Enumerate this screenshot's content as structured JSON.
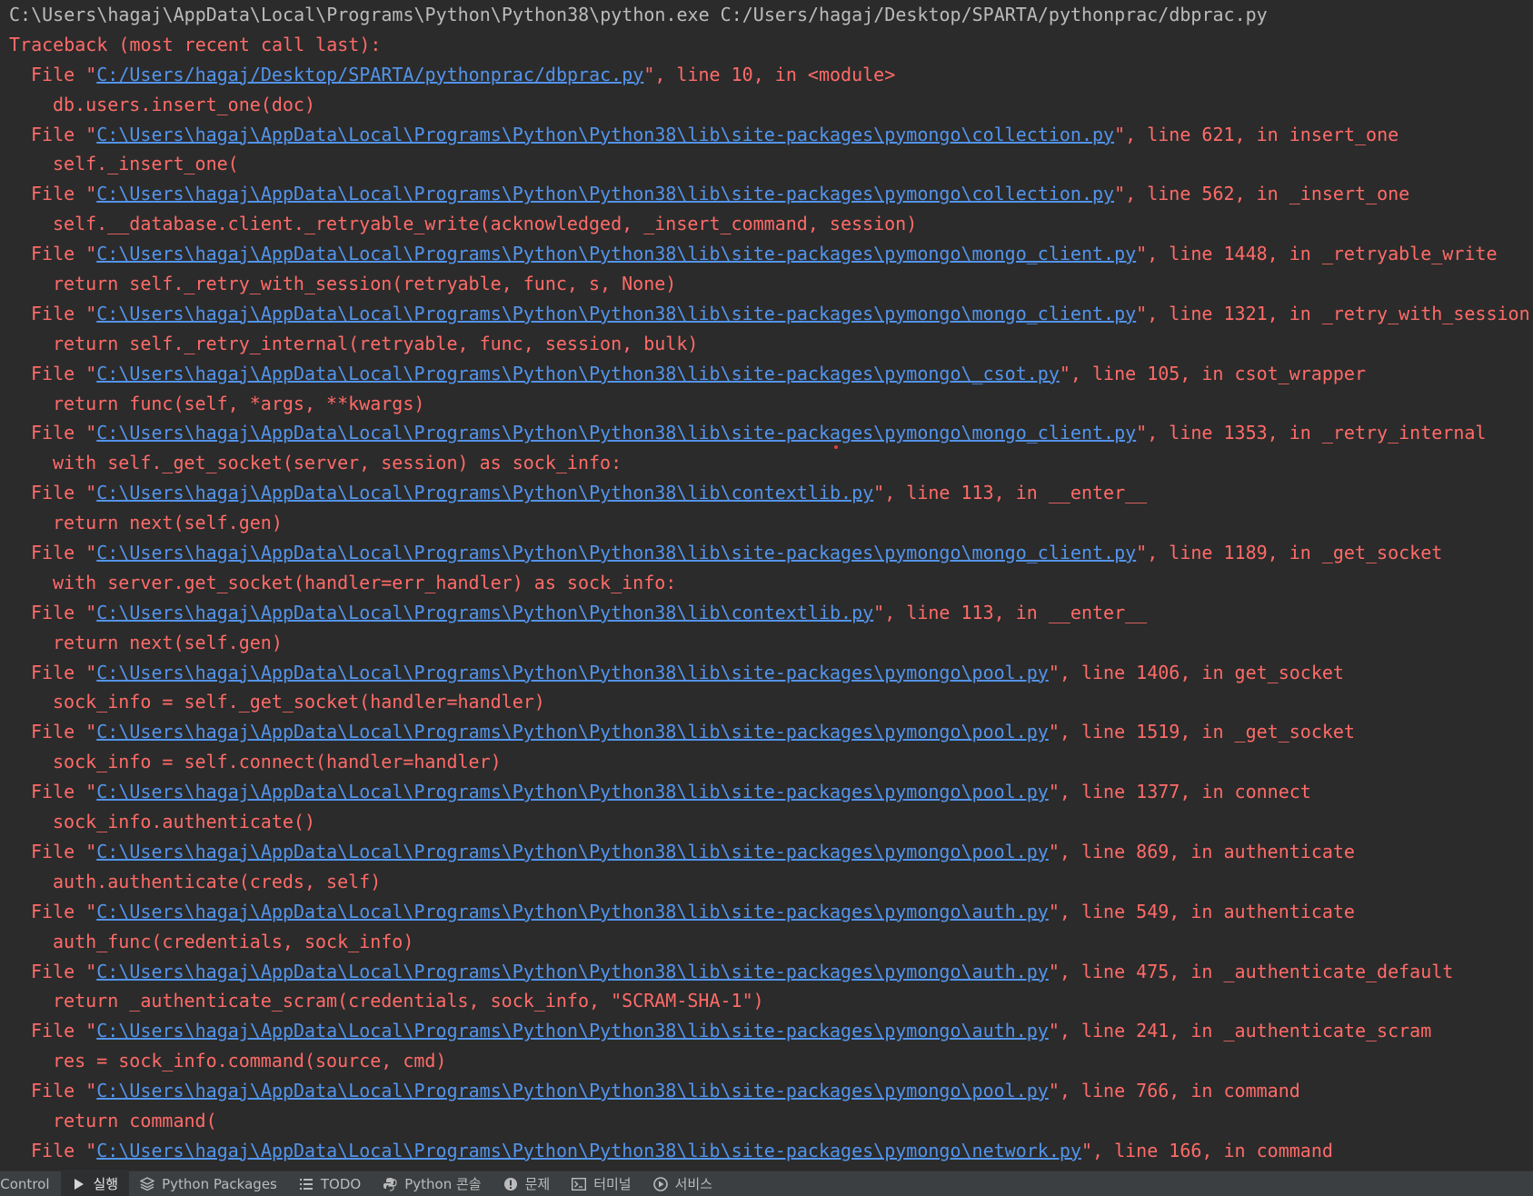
{
  "console": {
    "command": "C:\\Users\\hagaj\\AppData\\Local\\Programs\\Python\\Python38\\python.exe C:/Users/hagaj/Desktop/SPARTA/pythonprac/dbprac.py",
    "traceback_header": "Traceback (most recent call last):",
    "frames": [
      {
        "path": "C:/Users/hagaj/Desktop/SPARTA/pythonprac/dbprac.py",
        "suffix": "\", line 10, in <module>",
        "code": "db.users.insert_one(doc)"
      },
      {
        "path": "C:\\Users\\hagaj\\AppData\\Local\\Programs\\Python\\Python38\\lib\\site-packages\\pymongo\\collection.py",
        "suffix": "\", line 621, in insert_one",
        "code": "self._insert_one("
      },
      {
        "path": "C:\\Users\\hagaj\\AppData\\Local\\Programs\\Python\\Python38\\lib\\site-packages\\pymongo\\collection.py",
        "suffix": "\", line 562, in _insert_one",
        "code": "self.__database.client._retryable_write(acknowledged, _insert_command, session)"
      },
      {
        "path": "C:\\Users\\hagaj\\AppData\\Local\\Programs\\Python\\Python38\\lib\\site-packages\\pymongo\\mongo_client.py",
        "suffix": "\", line 1448, in _retryable_write",
        "code": "return self._retry_with_session(retryable, func, s, None)"
      },
      {
        "path": "C:\\Users\\hagaj\\AppData\\Local\\Programs\\Python\\Python38\\lib\\site-packages\\pymongo\\mongo_client.py",
        "suffix": "\", line 1321, in _retry_with_session",
        "code": "return self._retry_internal(retryable, func, session, bulk)"
      },
      {
        "path": "C:\\Users\\hagaj\\AppData\\Local\\Programs\\Python\\Python38\\lib\\site-packages\\pymongo\\_csot.py",
        "suffix": "\", line 105, in csot_wrapper",
        "code": "return func(self, *args, **kwargs)"
      },
      {
        "path": "C:\\Users\\hagaj\\AppData\\Local\\Programs\\Python\\Python38\\lib\\site-packages\\pymongo\\mongo_client.py",
        "suffix": "\", line 1353, in _retry_internal",
        "code": "with self._get_socket(server, session) as sock_info:"
      },
      {
        "path": "C:\\Users\\hagaj\\AppData\\Local\\Programs\\Python\\Python38\\lib\\contextlib.py",
        "suffix": "\", line 113, in __enter__",
        "code": "return next(self.gen)"
      },
      {
        "path": "C:\\Users\\hagaj\\AppData\\Local\\Programs\\Python\\Python38\\lib\\site-packages\\pymongo\\mongo_client.py",
        "suffix": "\", line 1189, in _get_socket",
        "code": "with server.get_socket(handler=err_handler) as sock_info:"
      },
      {
        "path": "C:\\Users\\hagaj\\AppData\\Local\\Programs\\Python\\Python38\\lib\\contextlib.py",
        "suffix": "\", line 113, in __enter__",
        "code": "return next(self.gen)"
      },
      {
        "path": "C:\\Users\\hagaj\\AppData\\Local\\Programs\\Python\\Python38\\lib\\site-packages\\pymongo\\pool.py",
        "suffix": "\", line 1406, in get_socket",
        "code": "sock_info = self._get_socket(handler=handler)"
      },
      {
        "path": "C:\\Users\\hagaj\\AppData\\Local\\Programs\\Python\\Python38\\lib\\site-packages\\pymongo\\pool.py",
        "suffix": "\", line 1519, in _get_socket",
        "code": "sock_info = self.connect(handler=handler)"
      },
      {
        "path": "C:\\Users\\hagaj\\AppData\\Local\\Programs\\Python\\Python38\\lib\\site-packages\\pymongo\\pool.py",
        "suffix": "\", line 1377, in connect",
        "code": "sock_info.authenticate()"
      },
      {
        "path": "C:\\Users\\hagaj\\AppData\\Local\\Programs\\Python\\Python38\\lib\\site-packages\\pymongo\\pool.py",
        "suffix": "\", line 869, in authenticate",
        "code": "auth.authenticate(creds, self)"
      },
      {
        "path": "C:\\Users\\hagaj\\AppData\\Local\\Programs\\Python\\Python38\\lib\\site-packages\\pymongo\\auth.py",
        "suffix": "\", line 549, in authenticate",
        "code": "auth_func(credentials, sock_info)"
      },
      {
        "path": "C:\\Users\\hagaj\\AppData\\Local\\Programs\\Python\\Python38\\lib\\site-packages\\pymongo\\auth.py",
        "suffix": "\", line 475, in _authenticate_default",
        "code": "return _authenticate_scram(credentials, sock_info, \"SCRAM-SHA-1\")"
      },
      {
        "path": "C:\\Users\\hagaj\\AppData\\Local\\Programs\\Python\\Python38\\lib\\site-packages\\pymongo\\auth.py",
        "suffix": "\", line 241, in _authenticate_scram",
        "code": "res = sock_info.command(source, cmd)"
      },
      {
        "path": "C:\\Users\\hagaj\\AppData\\Local\\Programs\\Python\\Python38\\lib\\site-packages\\pymongo\\pool.py",
        "suffix": "\", line 766, in command",
        "code": "return command("
      },
      {
        "path": "C:\\Users\\hagaj\\AppData\\Local\\Programs\\Python\\Python38\\lib\\site-packages\\pymongo\\network.py",
        "suffix": "\", line 166, in command",
        "code": null
      }
    ]
  },
  "toolbar": {
    "items": [
      {
        "label": "n Control",
        "icon": "none",
        "active": false
      },
      {
        "label": "실행",
        "icon": "run-icon",
        "active": true
      },
      {
        "label": "Python Packages",
        "icon": "packages-icon",
        "active": false
      },
      {
        "label": "TODO",
        "icon": "todo-icon",
        "active": false
      },
      {
        "label": "Python 콘솔",
        "icon": "python-console-icon",
        "active": false
      },
      {
        "label": "문제",
        "icon": "problems-icon",
        "active": false
      },
      {
        "label": "터미널",
        "icon": "terminal-icon",
        "active": false
      },
      {
        "label": "서비스",
        "icon": "services-icon",
        "active": false
      }
    ]
  },
  "colors": {
    "background": "#2b2b2b",
    "error_text": "#ff6b68",
    "link": "#5394ec",
    "command_text": "#bbbbbb",
    "toolbar_bg": "#3c3f41"
  }
}
